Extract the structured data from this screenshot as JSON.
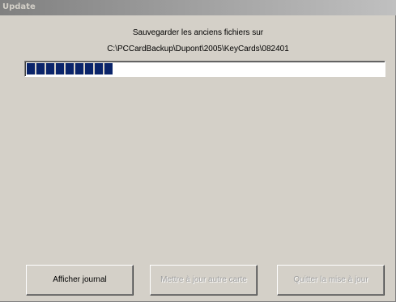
{
  "window": {
    "title": "Update"
  },
  "message": {
    "line1": "Sauvegarder les anciens fichiers sur",
    "line2": "C:\\PCCardBackup\\Dupont\\2005\\KeyCards\\082401"
  },
  "progress": {
    "fraction": 0.235
  },
  "buttons": {
    "show_log": {
      "label": "Afficher journal",
      "enabled": true
    },
    "update_other_card": {
      "label": "Mettre à jour autre carte",
      "enabled": false
    },
    "quit_update": {
      "label": "Quitter la mise à jour",
      "enabled": false
    }
  },
  "colors": {
    "face": "#d4d0c8",
    "progress_fill": "#0a246a",
    "titlebar_start": "#808080",
    "titlebar_end": "#c0c0c0"
  }
}
